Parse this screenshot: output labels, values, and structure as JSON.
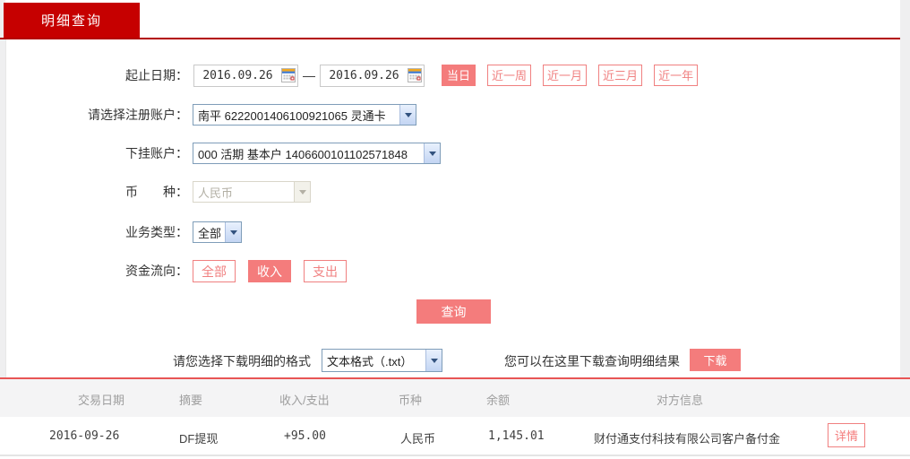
{
  "colors": {
    "brand_red": "#c60000",
    "underline_red": "#b30000",
    "salmon": "#f47c7c",
    "separator_pink": "#e85555",
    "amount_red": "#dd0000"
  },
  "tab": {
    "label": "明细查询"
  },
  "form": {
    "date_range": {
      "label": "起止日期：",
      "start_value": "2016.09.26",
      "end_value": "2016.09.26",
      "separator": "—",
      "quick_buttons": [
        {
          "label": "当日",
          "active": true
        },
        {
          "label": "近一周",
          "active": false
        },
        {
          "label": "近一月",
          "active": false
        },
        {
          "label": "近三月",
          "active": false
        },
        {
          "label": "近一年",
          "active": false
        }
      ]
    },
    "register_account": {
      "label": "请选择注册账户：",
      "value": "南平 6222001406100921065 灵通卡"
    },
    "sub_account": {
      "label": "下挂账户：",
      "value": "000 活期 基本户 1406600101102571848"
    },
    "currency": {
      "label": "币　　种：",
      "value": "人民币",
      "disabled": true
    },
    "business_type": {
      "label": "业务类型：",
      "value": "全部"
    },
    "fund_flow": {
      "label": "资金流向：",
      "options": [
        {
          "label": "全部",
          "active": false
        },
        {
          "label": "收入",
          "active": true
        },
        {
          "label": "支出",
          "active": false
        }
      ]
    },
    "query_button": "查询"
  },
  "download": {
    "format_label": "请您选择下载明细的格式",
    "format_value": "文本格式（.txt）",
    "hint": "您可以在这里下载查询明细结果",
    "button_label": "下载"
  },
  "table": {
    "headers": {
      "date": "交易日期",
      "summary": "摘要",
      "in_out": "收入/支出",
      "currency": "币种",
      "balance": "余额",
      "counterparty": "对方信息"
    },
    "rows": [
      {
        "date": "2016-09-26",
        "summary": "DF提现",
        "amount": "+95.00",
        "currency": "人民币",
        "balance": "1,145.01",
        "counterparty": "财付通支付科技有限公司客户备付金",
        "action": "详情"
      }
    ]
  }
}
